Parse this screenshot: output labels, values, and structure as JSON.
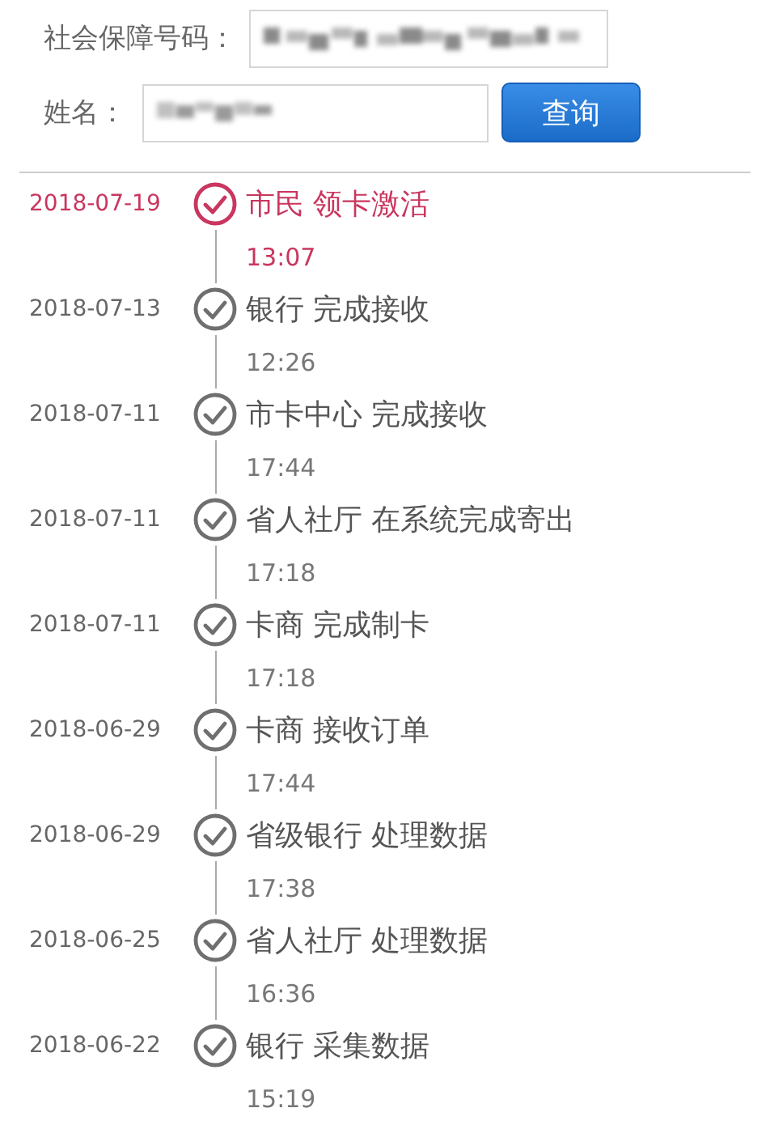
{
  "form": {
    "id_label": "社会保障号码：",
    "name_label": "姓名：",
    "search_button": "查询"
  },
  "timeline": [
    {
      "date": "2018-07-19",
      "event": "市民 领卡激活",
      "time": "13:07",
      "active": true
    },
    {
      "date": "2018-07-13",
      "event": "银行 完成接收",
      "time": "12:26",
      "active": false
    },
    {
      "date": "2018-07-11",
      "event": "市卡中心 完成接收",
      "time": "17:44",
      "active": false
    },
    {
      "date": "2018-07-11",
      "event": "省人社厅 在系统完成寄出",
      "time": "17:18",
      "active": false
    },
    {
      "date": "2018-07-11",
      "event": "卡商 完成制卡",
      "time": "17:18",
      "active": false
    },
    {
      "date": "2018-06-29",
      "event": "卡商 接收订单",
      "time": "17:44",
      "active": false
    },
    {
      "date": "2018-06-29",
      "event": "省级银行 处理数据",
      "time": "17:38",
      "active": false
    },
    {
      "date": "2018-06-25",
      "event": "省人社厅 处理数据",
      "time": "16:36",
      "active": false
    },
    {
      "date": "2018-06-22",
      "event": "银行 采集数据",
      "time": "15:19",
      "active": false
    }
  ]
}
